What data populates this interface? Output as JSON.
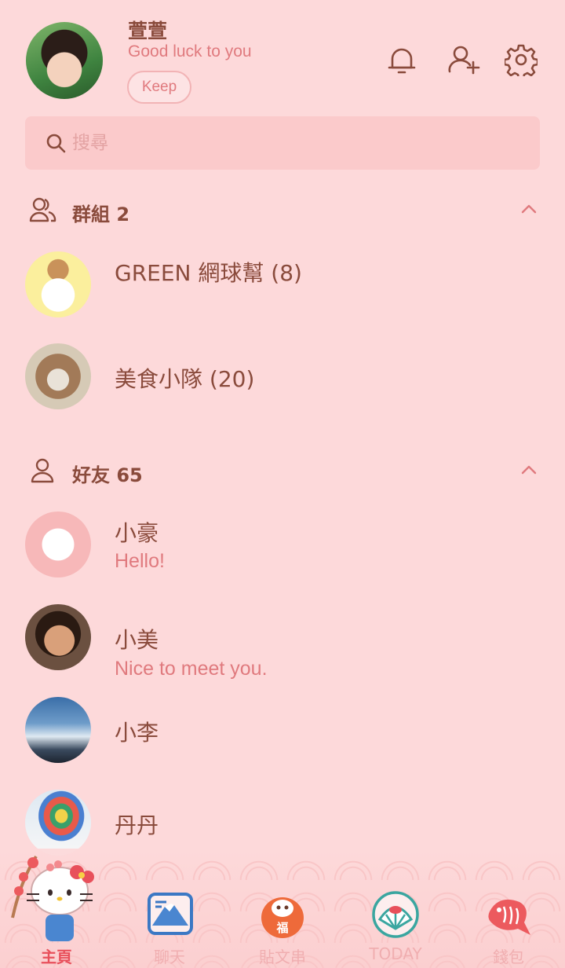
{
  "profile": {
    "name": "萱萱",
    "status": "Good luck to you",
    "keep_label": "Keep"
  },
  "header_icons": [
    "bell-icon",
    "add-friend-icon",
    "settings-gear-icon"
  ],
  "search": {
    "placeholder": "搜尋"
  },
  "groups": {
    "title": "群組 2",
    "items": [
      {
        "name": "GREEN 網球幫 (8)",
        "avatar": "hello-kitty-bear-avatar"
      },
      {
        "name": "美食小隊 (20)",
        "avatar": "cat-avatar"
      }
    ]
  },
  "friends": {
    "title": "好友 65",
    "items": [
      {
        "name": "小豪",
        "message": "Hello!",
        "avatar": "hello-kitty-avatar"
      },
      {
        "name": "小美",
        "message": "Nice to meet you.",
        "avatar": "woman-avatar"
      },
      {
        "name": "小李",
        "message": "",
        "avatar": "sky-avatar"
      },
      {
        "name": "丹丹",
        "message": "",
        "avatar": "hot-air-balloon-avatar"
      }
    ]
  },
  "nav": {
    "items": [
      {
        "label": "主頁",
        "icon": "hello-kitty-home-icon",
        "active": true
      },
      {
        "label": "聊天",
        "icon": "mount-fuji-chat-icon",
        "active": false
      },
      {
        "label": "貼文串",
        "icon": "daruma-timeline-icon",
        "active": false
      },
      {
        "label": "TODAY",
        "icon": "fan-today-icon",
        "active": false
      },
      {
        "label": "錢包",
        "icon": "sea-bream-wallet-icon",
        "active": false
      }
    ]
  },
  "colors": {
    "background": "#fdd9da",
    "text_primary": "#8a4b3c",
    "text_accent": "#e07a7e",
    "nav_active": "#e8505b",
    "nav_inactive": "#f0aeb0"
  }
}
